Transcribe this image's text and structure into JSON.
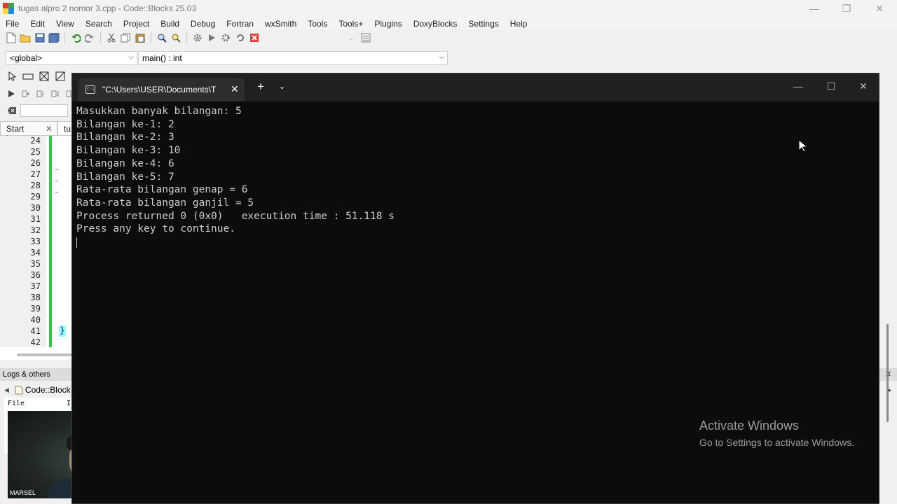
{
  "codeblocks": {
    "window_title": "tugas alpro 2 nomor 3.cpp - Code::Blocks 25.03",
    "menu": [
      "File",
      "Edit",
      "View",
      "Search",
      "Project",
      "Build",
      "Debug",
      "Fortran",
      "wxSmith",
      "Tools",
      "Tools+",
      "Plugins",
      "DoxyBlocks",
      "Settings",
      "Help"
    ],
    "scope_combo": "<global>",
    "function_combo": "main() : int",
    "tabs": [
      {
        "label": "Start here"
      },
      {
        "label": "tu"
      }
    ],
    "line_numbers": [
      "24",
      "25",
      "26",
      "27",
      "28",
      "29",
      "30",
      "31",
      "32",
      "33",
      "34",
      "35",
      "36",
      "37",
      "38",
      "39",
      "40",
      "41",
      "42"
    ],
    "closing_brace": "}",
    "logs_panel_title": "Logs & others",
    "logs_tab": "Code::Block",
    "logs_column_file": "File",
    "logs_column_second": "I"
  },
  "webcam": {
    "name_label": "MARSEL"
  },
  "console": {
    "tab_title": "\"C:\\Users\\USER\\Documents\\T",
    "tab_icon_text": "C:\\",
    "lines": [
      "Masukkan banyak bilangan: 5",
      "Bilangan ke-1: 2",
      "Bilangan ke-2: 3",
      "Bilangan ke-3: 10",
      "Bilangan ke-4: 6",
      "Bilangan ke-5: 7",
      "Rata-rata bilangan genap = 6",
      "Rata-rata bilangan ganjil = 5",
      "",
      "Process returned 0 (0x0)   execution time : 51.118 s",
      "Press any key to continue."
    ]
  },
  "watermark": {
    "title": "Activate Windows",
    "subtitle": "Go to Settings to activate Windows."
  },
  "colors": {
    "console_bg": "#0c0c0c",
    "console_text": "#cccccc",
    "tabbar_bg": "#202020",
    "change_bar": "#2ecc40"
  }
}
